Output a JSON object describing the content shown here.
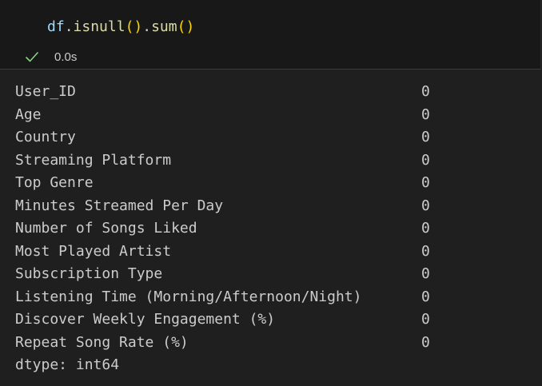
{
  "code_cell": {
    "code_tokens": {
      "var": "df",
      "dot1": ".",
      "fn1": "isnull",
      "paren1": "()",
      "dot2": ".",
      "fn2": "sum",
      "paren2": "()"
    },
    "status_icon": "check-icon",
    "status_color": "#89d185",
    "execution_time": "0.0s"
  },
  "output": {
    "rows": [
      {
        "name": "User_ID",
        "value": "0"
      },
      {
        "name": "Age",
        "value": "0"
      },
      {
        "name": "Country",
        "value": "0"
      },
      {
        "name": "Streaming Platform",
        "value": "0"
      },
      {
        "name": "Top Genre",
        "value": "0"
      },
      {
        "name": "Minutes Streamed Per Day",
        "value": "0"
      },
      {
        "name": "Number of Songs Liked",
        "value": "0"
      },
      {
        "name": "Most Played Artist",
        "value": "0"
      },
      {
        "name": "Subscription Type",
        "value": "0"
      },
      {
        "name": "Listening Time (Morning/Afternoon/Night)",
        "value": "0"
      },
      {
        "name": "Discover Weekly Engagement (%)",
        "value": "0"
      },
      {
        "name": "Repeat Song Rate (%)",
        "value": "0"
      }
    ],
    "dtype_line": "dtype: int64"
  }
}
